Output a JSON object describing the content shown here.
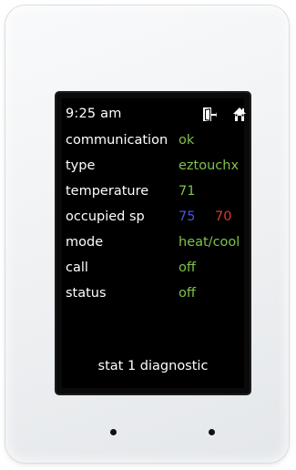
{
  "status_bar": {
    "time": "9:25 am",
    "icons": [
      "door-exit-icon",
      "house-icon"
    ]
  },
  "diagnostics": [
    {
      "label": "communication",
      "value": "ok"
    },
    {
      "label": "type",
      "value": "eztouchx"
    },
    {
      "label": "temperature",
      "value": "71"
    },
    {
      "label": "occupied sp",
      "cool_setpoint": "75",
      "heat_setpoint": "70"
    },
    {
      "label": "mode",
      "value": "heat/cool"
    },
    {
      "label": "call",
      "value": "off"
    },
    {
      "label": "status",
      "value": "off"
    }
  ],
  "footer": {
    "title": "stat 1 diagnostic"
  },
  "colors": {
    "value_green": "#7ec24a",
    "cool_blue": "#4a55d8",
    "heat_red": "#d83a2c",
    "screen_bg": "#000000",
    "housing": "#f3f4f6"
  }
}
